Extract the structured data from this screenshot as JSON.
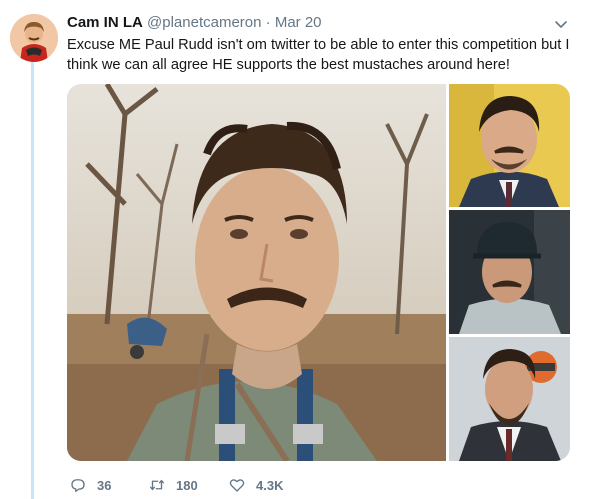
{
  "tweet": {
    "display_name": "Cam IN LA",
    "handle": "@planetcameron",
    "separator": "·",
    "date": "Mar 20",
    "text": "Excuse ME Paul Rudd isn't om twitter to be able to enter this competition but I think we can all agree HE supports the best mustaches around here!"
  },
  "actions": {
    "reply_count": "36",
    "retweet_count": "180",
    "like_count": "4.3K"
  },
  "icons": {
    "reply": "reply-icon",
    "retweet": "retweet-icon",
    "like": "heart-icon",
    "menu": "chevron-down-icon"
  },
  "colors": {
    "text": "#14171a",
    "secondary": "#657786",
    "thread_line": "#c9e4f6"
  }
}
